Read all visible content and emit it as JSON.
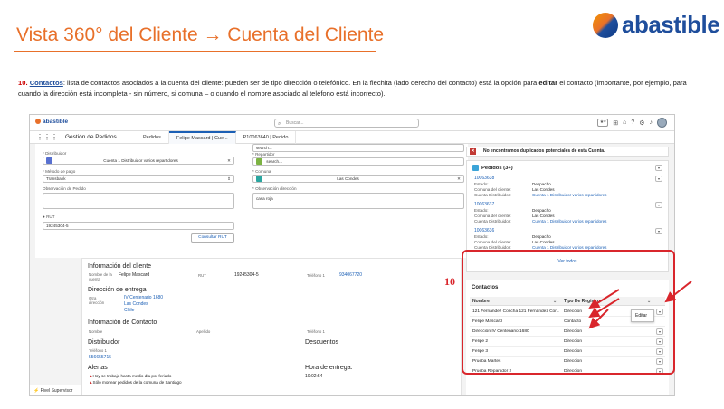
{
  "slide": {
    "title": "Vista 360° del Cliente → Cuenta del Cliente",
    "brand": "abastible",
    "desc_num": "10.",
    "desc_kw": "Contactos",
    "desc_p1": ": lista de contactos asociados a la cuenta del cliente: pueden ser de tipo dirección o telefónico. En la flechita (lado derecho del contacto) está la opción para ",
    "desc_bold": "editar",
    "desc_p2": " el contacto (importante, por ejemplo, para cuando la dirección está incompleta - sin número, si comuna – o cuando el nombre asociado al teléfono está incorrecto).",
    "annotation": "10",
    "colors": {
      "accent": "#e8702a",
      "brand_blue": "#1f4e9c",
      "highlight_red": "#d9262c"
    }
  },
  "app": {
    "logo": "abastible",
    "search_placeholder": "Buscar...",
    "app_name": "Gestión de Pedidos ...",
    "tabs": [
      "Pedidos",
      "Felipe Mascard | Cue...",
      "P10063640 | Pedido"
    ],
    "utility": "Fivel Supervisor Plus"
  },
  "form": {
    "distribuidor_label": "* Distribuidor",
    "distribuidor_value": "Cuenta 1 Distribuidor varios repartidores",
    "repartidor_label": "* Repartidor",
    "repartidor_placeholder": "search...",
    "top_search_placeholder": "search...",
    "pago_label": "* Método de pago",
    "pago_value": "Transbank",
    "comuna_label": "* Comuna",
    "comuna_value": "Las Condes",
    "obs_pedido_label": "Observación de Pedido",
    "obs_dir_label": "* Observación dirección",
    "obs_dir_value": "casa roja",
    "rut_label": "RUT",
    "rut_value": "19245304-5",
    "consultar_rut": "Consultar RUT"
  },
  "info": {
    "h_cliente": "Información del cliente",
    "nombre_label": "Nombre de la cuenta",
    "nombre_value": "Felipe Mascard",
    "rut_label": "RUT",
    "rut_value": "19245304-5",
    "tel_label": "Teléfono 1",
    "tel_value": "934067720",
    "h_dir": "Dirección de entrega",
    "otra_dir_label": "Otra dirección",
    "dir_line1": "IV Centenario 1680",
    "dir_line2": "Las Condes",
    "dir_line3": "Chile",
    "h_contacto": "Información de Contacto",
    "c_nombre_label": "Nombre",
    "c_apellido_label": "Apellido",
    "c_tel_label": "Teléfono 1",
    "h_distribuidor": "Distribuidor",
    "d_tel_label": "Teléfono 1",
    "d_tel_value": "556655715",
    "h_descuentos": "Descuentos",
    "h_alertas": "Alertas",
    "alert1": "Hoy se trabaja hasta medio día por feriado",
    "alert2": "Sólo monear pedidos de la comuna de Santiago",
    "h_hora": "Hora de entrega:",
    "hora_value": "10:02:54"
  },
  "right": {
    "warning": "No encontramos duplicados potenciales de esta Cuenta.",
    "pedidos_title": "Pedidos (3+)",
    "orders": [
      {
        "id": "10063638",
        "estado_k": "Estado:",
        "estado_v": "Despacho",
        "comuna_k": "Comuna del cliente:",
        "comuna_v": "Las Condes",
        "dist_k": "Cuenta Distribuidor:",
        "dist_v": "Cuenta 1 Distribuidor varios repartidores"
      },
      {
        "id": "10063637",
        "estado_k": "Estado:",
        "estado_v": "Despacho",
        "comuna_k": "Comuna del cliente:",
        "comuna_v": "Las Condes",
        "dist_k": "Cuenta Distribuidor:",
        "dist_v": "Cuenta 1 Distribuidor varios repartidores"
      },
      {
        "id": "10063636",
        "estado_k": "Estado:",
        "estado_v": "Despacho",
        "comuna_k": "Comuna del cliente:",
        "comuna_v": "Las Condes",
        "dist_k": "Cuenta Distribuidor:",
        "dist_v": "Cuenta 1 Distribuidor varios repartidores"
      }
    ],
    "ver_todos": "Ver todos"
  },
  "contactos": {
    "title": "Contactos",
    "col_nombre": "Nombre",
    "col_tipo": "Tipo De Registro",
    "rows": [
      {
        "nombre": "121 Fernández Concha 121 Fernández Con...",
        "tipo": "Direccion"
      },
      {
        "nombre": "Felipe Mascard",
        "tipo": "Contacto"
      },
      {
        "nombre": "Dirección IV Centenario 1680",
        "tipo": "Direccion"
      },
      {
        "nombre": "Felipe 2",
        "tipo": "Direccion"
      },
      {
        "nombre": "Felipe 3",
        "tipo": "Direccion"
      },
      {
        "nombre": "Prueba Martes",
        "tipo": "Direccion"
      },
      {
        "nombre": "Prueba Repartidor 2",
        "tipo": "Direccion"
      }
    ],
    "menu_editar": "Editar"
  }
}
